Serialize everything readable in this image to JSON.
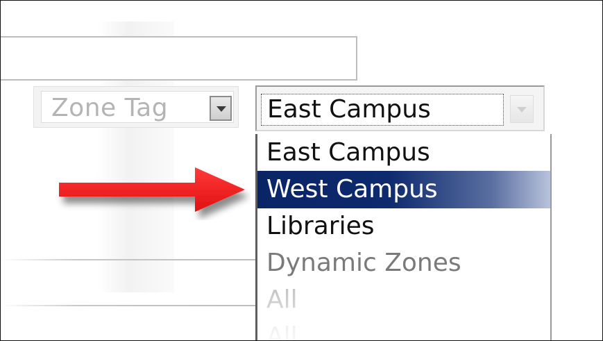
{
  "zone_tag": {
    "label": "Zone Tag"
  },
  "campus_select": {
    "selected_value": "East Campus",
    "options": [
      {
        "label": "East Campus",
        "color": "#111111",
        "selected": false
      },
      {
        "label": "West Campus",
        "color": "#ffffff",
        "selected": true
      },
      {
        "label": "Libraries",
        "color": "#111111",
        "selected": false
      },
      {
        "label": "Dynamic Zones",
        "color": "#7a7a7a",
        "selected": false
      },
      {
        "label": "All",
        "color": "#bcbcbc",
        "selected": false
      },
      {
        "label": "All",
        "color": "#d6d6d6",
        "selected": false
      }
    ]
  },
  "pointer": {
    "icon": "red-arrow-right-icon",
    "color": "#e01010"
  }
}
